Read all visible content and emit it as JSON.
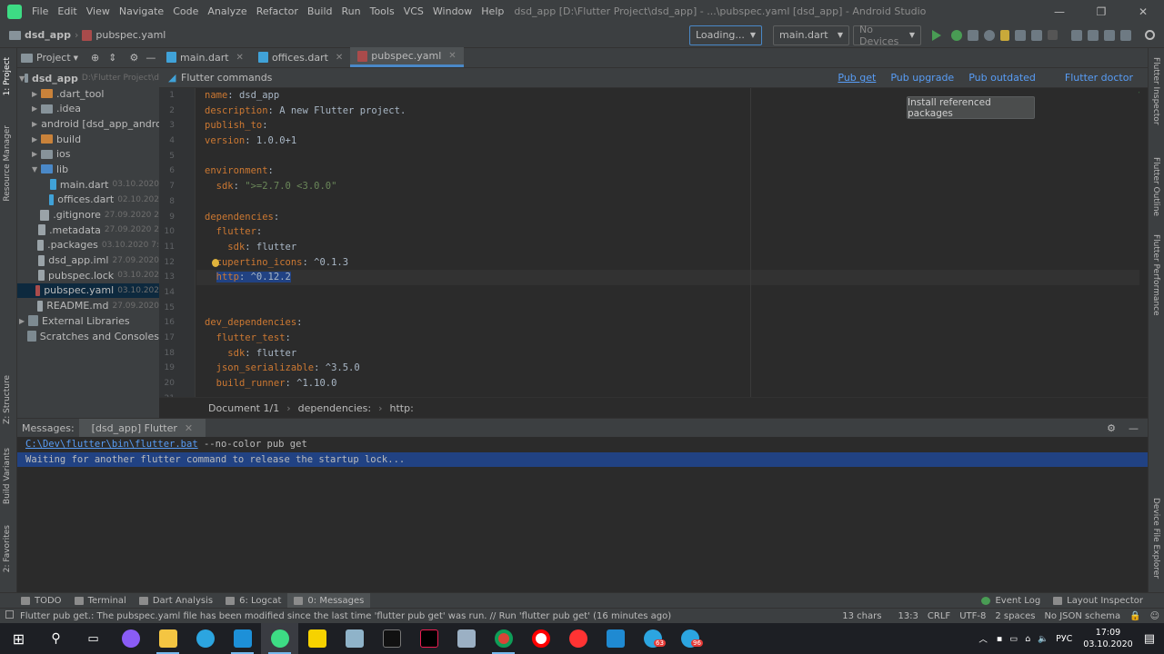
{
  "menubar": {
    "items": [
      "File",
      "Edit",
      "View",
      "Navigate",
      "Code",
      "Analyze",
      "Refactor",
      "Build",
      "Run",
      "Tools",
      "VCS",
      "Window",
      "Help"
    ],
    "title": "dsd_app [D:\\Flutter Project\\dsd_app] - ...\\pubspec.yaml [dsd_app] - Android Studio"
  },
  "navbar": {
    "project": "dsd_app",
    "file": "pubspec.yaml",
    "loading": "Loading...",
    "run_config": "main.dart",
    "device": "No Devices"
  },
  "left_strip": [
    "1: Project",
    "Resource Manager",
    "Z: Structure",
    "Build Variants",
    "2: Favorites"
  ],
  "right_strip": [
    "Flutter Inspector",
    "Flutter Outline",
    "Flutter Performance",
    "Device File Explorer"
  ],
  "project_panel": {
    "header": "Project",
    "tree": [
      {
        "name": "dsd_app",
        "extra": "D:\\Flutter Project\\d",
        "indent": 0,
        "arrow": "▼",
        "type": "folder",
        "bold": true
      },
      {
        "name": ".dart_tool",
        "extra": "",
        "indent": 1,
        "arrow": "▶",
        "type": "folder-orange"
      },
      {
        "name": ".idea",
        "extra": "",
        "indent": 1,
        "arrow": "▶",
        "type": "folder"
      },
      {
        "name": "android [dsd_app_andro",
        "extra": "",
        "indent": 1,
        "arrow": "▶",
        "type": "folder"
      },
      {
        "name": "build",
        "extra": "",
        "indent": 1,
        "arrow": "▶",
        "type": "folder-orange"
      },
      {
        "name": "ios",
        "extra": "",
        "indent": 1,
        "arrow": "▶",
        "type": "folder"
      },
      {
        "name": "lib",
        "extra": "",
        "indent": 1,
        "arrow": "▼",
        "type": "folder-blue"
      },
      {
        "name": "main.dart",
        "extra": "03.10.2020",
        "indent": 2,
        "arrow": "",
        "type": "dart"
      },
      {
        "name": "offices.dart",
        "extra": "02.10.202",
        "indent": 2,
        "arrow": "",
        "type": "dart"
      },
      {
        "name": ".gitignore",
        "extra": "27.09.2020 2",
        "indent": 1,
        "arrow": "",
        "type": "file"
      },
      {
        "name": ".metadata",
        "extra": "27.09.2020 2",
        "indent": 1,
        "arrow": "",
        "type": "file"
      },
      {
        "name": ".packages",
        "extra": "03.10.2020 7:",
        "indent": 1,
        "arrow": "",
        "type": "file"
      },
      {
        "name": "dsd_app.iml",
        "extra": "27.09.2020",
        "indent": 1,
        "arrow": "",
        "type": "file"
      },
      {
        "name": "pubspec.lock",
        "extra": "03.10.202",
        "indent": 1,
        "arrow": "",
        "type": "file"
      },
      {
        "name": "pubspec.yaml",
        "extra": "03.10.202",
        "indent": 1,
        "arrow": "",
        "type": "yaml",
        "selected": true
      },
      {
        "name": "README.md",
        "extra": "27.09.2020",
        "indent": 1,
        "arrow": "",
        "type": "file"
      },
      {
        "name": "External Libraries",
        "extra": "",
        "indent": 0,
        "arrow": "▶",
        "type": "lib"
      },
      {
        "name": "Scratches and Consoles",
        "extra": "",
        "indent": 0,
        "arrow": "",
        "type": "lib"
      }
    ]
  },
  "editor": {
    "tabs": [
      {
        "label": "main.dart",
        "active": false
      },
      {
        "label": "offices.dart",
        "active": false
      },
      {
        "label": "pubspec.yaml",
        "active": true
      }
    ],
    "commands_label": "Flutter commands",
    "commands": [
      "Pub get",
      "Pub upgrade",
      "Pub outdated",
      "Flutter doctor"
    ],
    "tooltip": "Install referenced packages",
    "line_numbers": [
      "1",
      "2",
      "3",
      "4",
      "5",
      "6",
      "7",
      "8",
      "9",
      "10",
      "11",
      "12",
      "13",
      "14",
      "15",
      "16",
      "17",
      "18",
      "19",
      "20",
      "21"
    ],
    "lines": [
      [
        {
          "t": "k",
          "v": "name"
        },
        {
          "t": "v",
          "v": ": dsd_app"
        }
      ],
      [
        {
          "t": "k",
          "v": "description"
        },
        {
          "t": "v",
          "v": ": A new Flutter project."
        }
      ],
      [
        {
          "t": "k",
          "v": "publish_to"
        },
        {
          "t": "v",
          "v": ":"
        }
      ],
      [
        {
          "t": "k",
          "v": "version"
        },
        {
          "t": "v",
          "v": ": 1.0.0+1"
        }
      ],
      [],
      [
        {
          "t": "k",
          "v": "environment"
        },
        {
          "t": "v",
          "v": ":"
        }
      ],
      [
        {
          "t": "v",
          "v": "  "
        },
        {
          "t": "k",
          "v": "sdk"
        },
        {
          "t": "v",
          "v": ": "
        },
        {
          "t": "s",
          "v": "\">=2.7.0 <3.0.0\""
        }
      ],
      [],
      [
        {
          "t": "k",
          "v": "dependencies"
        },
        {
          "t": "v",
          "v": ":"
        }
      ],
      [
        {
          "t": "v",
          "v": "  "
        },
        {
          "t": "k",
          "v": "flutter"
        },
        {
          "t": "v",
          "v": ":"
        }
      ],
      [
        {
          "t": "v",
          "v": "    "
        },
        {
          "t": "k",
          "v": "sdk"
        },
        {
          "t": "v",
          "v": ": flutter"
        }
      ],
      [
        {
          "t": "v",
          "v": "  "
        },
        {
          "t": "k",
          "v": "cupertino_icons"
        },
        {
          "t": "v",
          "v": ": ^0.1.3"
        }
      ],
      [
        {
          "t": "v",
          "v": "  "
        },
        {
          "t": "hk",
          "v": "http"
        },
        {
          "t": "hv",
          "v": ": ^0.12.2"
        }
      ],
      [],
      [],
      [
        {
          "t": "k",
          "v": "dev_dependencies"
        },
        {
          "t": "v",
          "v": ":"
        }
      ],
      [
        {
          "t": "v",
          "v": "  "
        },
        {
          "t": "k",
          "v": "flutter_test"
        },
        {
          "t": "v",
          "v": ":"
        }
      ],
      [
        {
          "t": "v",
          "v": "    "
        },
        {
          "t": "k",
          "v": "sdk"
        },
        {
          "t": "v",
          "v": ": flutter"
        }
      ],
      [
        {
          "t": "v",
          "v": "  "
        },
        {
          "t": "k",
          "v": "json_serializable"
        },
        {
          "t": "v",
          "v": ": ^3.5.0"
        }
      ],
      [
        {
          "t": "v",
          "v": "  "
        },
        {
          "t": "k",
          "v": "build_runner"
        },
        {
          "t": "v",
          "v": ": ^1.10.0"
        }
      ],
      []
    ],
    "breadcrumbs": [
      "Document 1/1",
      "dependencies:",
      "http:"
    ]
  },
  "messages": {
    "label": "Messages:",
    "tab": "[dsd_app] Flutter",
    "link": "C:\\Dev\\flutter\\bin\\flutter.bat",
    "cmd": " --no-color pub get",
    "waiting": "Waiting for another flutter command to release the startup lock..."
  },
  "tool_windows": [
    "TODO",
    "Terminal",
    "Dart Analysis",
    "6: Logcat",
    "0: Messages"
  ],
  "tool_right": [
    "Event Log",
    "Layout Inspector"
  ],
  "status": {
    "message": "Flutter pub get.: The pubspec.yaml file has been modified since the last time 'flutter pub get' was run. // Run 'flutter pub get' (16 minutes ago)",
    "items": [
      "13 chars",
      "13:3",
      "CRLF",
      "UTF-8",
      "2 spaces",
      "No JSON schema"
    ]
  },
  "taskbar": {
    "lang": "РУС",
    "time": "17:09",
    "date": "03.10.2020",
    "badges": [
      "63",
      "96"
    ]
  },
  "colors": {
    "accent": "#4a88c7",
    "link": "#589df6",
    "selection": "#214283",
    "keyword": "#cc7832",
    "string": "#6a8759"
  }
}
